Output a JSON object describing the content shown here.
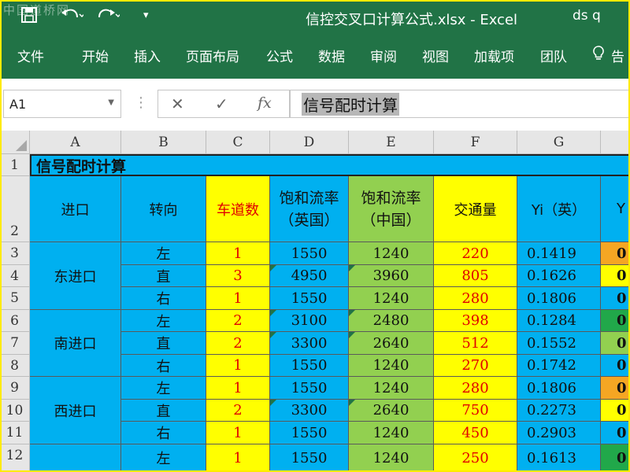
{
  "app": {
    "watermark": "中国道桥网",
    "doc_title": "信控交叉口计算公式.xlsx  -  Excel",
    "user": "ds q",
    "quick_access": {
      "save_icon": "save-icon",
      "undo_icon": "undo-icon",
      "redo_icon": "redo-icon",
      "customize": "▾"
    }
  },
  "ribbon": {
    "tabs": [
      "文件",
      "开始",
      "插入",
      "页面布局",
      "公式",
      "数据",
      "审阅",
      "视图",
      "加载项",
      "团队",
      "告"
    ],
    "tell_me_icon": "lightbulb-icon"
  },
  "formula_bar": {
    "name_box": "A1",
    "cancel": "✕",
    "enter": "✓",
    "fx": "fx",
    "content": "信号配时计算"
  },
  "columns": [
    "A",
    "B",
    "C",
    "D",
    "E",
    "F",
    "G"
  ],
  "rows": [
    "1",
    "2",
    "3",
    "4",
    "5",
    "6",
    "7",
    "8",
    "9",
    "10",
    "11",
    "12"
  ],
  "sheet": {
    "title": "信号配时计算",
    "headers": {
      "approach": "进口",
      "turn": "转向",
      "lanes": "车道数",
      "sat_uk_1": "饱和流率",
      "sat_uk_2": "（英国）",
      "sat_cn_1": "饱和流率",
      "sat_cn_2": "（中国）",
      "volume": "交通量",
      "yi_uk": "Yi（英）",
      "h_partial": "Y"
    },
    "approaches": [
      "东进口",
      "南进口",
      "西进口"
    ],
    "data_rows": [
      {
        "turn": "左",
        "lanes": "1",
        "sat_uk": "1550",
        "sat_cn": "1240",
        "volume": "220",
        "yi": "0.1419",
        "h": "0"
      },
      {
        "turn": "直",
        "lanes": "3",
        "sat_uk": "4950",
        "sat_cn": "3960",
        "volume": "805",
        "yi": "0.1626",
        "h": "0"
      },
      {
        "turn": "右",
        "lanes": "1",
        "sat_uk": "1550",
        "sat_cn": "1240",
        "volume": "280",
        "yi": "0.1806",
        "h": "0"
      },
      {
        "turn": "左",
        "lanes": "2",
        "sat_uk": "3100",
        "sat_cn": "2480",
        "volume": "398",
        "yi": "0.1284",
        "h": "0"
      },
      {
        "turn": "直",
        "lanes": "2",
        "sat_uk": "3300",
        "sat_cn": "2640",
        "volume": "512",
        "yi": "0.1552",
        "h": "0"
      },
      {
        "turn": "右",
        "lanes": "1",
        "sat_uk": "1550",
        "sat_cn": "1240",
        "volume": "270",
        "yi": "0.1742",
        "h": "0"
      },
      {
        "turn": "左",
        "lanes": "1",
        "sat_uk": "1550",
        "sat_cn": "1240",
        "volume": "280",
        "yi": "0.1806",
        "h": "0"
      },
      {
        "turn": "直",
        "lanes": "2",
        "sat_uk": "3300",
        "sat_cn": "2640",
        "volume": "750",
        "yi": "0.2273",
        "h": "0"
      },
      {
        "turn": "右",
        "lanes": "1",
        "sat_uk": "1550",
        "sat_cn": "1240",
        "volume": "450",
        "yi": "0.2903",
        "h": "0"
      },
      {
        "turn": "左",
        "lanes": "1",
        "sat_uk": "1550",
        "sat_cn": "1240",
        "volume": "250",
        "yi": "0.1613",
        "h": "0"
      }
    ],
    "h_colors": [
      "#f5a623",
      "#ffff00",
      "#00b0f0",
      "#21a84a",
      "#92d050",
      "#00b0f0",
      "#f5a623",
      "#ffff00",
      "#00b0f0",
      "#21a84a"
    ],
    "colors": {
      "blue": "#00b0f0",
      "yellow": "#ffff00",
      "green": "#92d050",
      "red_text": "#e00000",
      "excel_green": "#217346"
    }
  }
}
